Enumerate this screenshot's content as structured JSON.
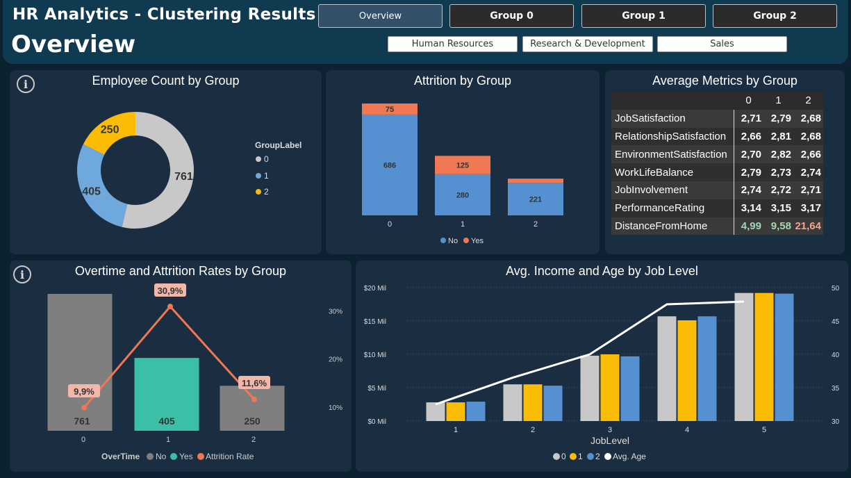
{
  "header": {
    "app_title": "HR Analytics - Clustering Results",
    "page_title": "Overview",
    "nav": [
      "Overview",
      "Group 0",
      "Group 1",
      "Group 2"
    ],
    "departments": [
      "Human Resources",
      "Research & Development",
      "Sales"
    ]
  },
  "colors": {
    "group0": "#c8c8c8",
    "group1": "#6fa8dc",
    "group2": "#fbbc05",
    "no": "#5591d1",
    "yes": "#f07853"
  },
  "donut": {
    "title": "Employee Count by Group",
    "legend_title": "GroupLabel",
    "legend": [
      "0",
      "1",
      "2"
    ],
    "chart_data": {
      "type": "pie",
      "categories": [
        "0",
        "1",
        "2"
      ],
      "values": [
        761,
        405,
        250
      ],
      "labels": [
        "761",
        "405",
        "250"
      ]
    }
  },
  "attrition": {
    "title": "Attrition by Group",
    "legend": [
      "No",
      "Yes"
    ],
    "chart_data": {
      "type": "bar",
      "categories": [
        "0",
        "1",
        "2"
      ],
      "series": [
        {
          "name": "No",
          "values": [
            686,
            280,
            221
          ],
          "labels": [
            "686",
            "280",
            "221"
          ]
        },
        {
          "name": "Yes",
          "values": [
            75,
            125,
            29
          ],
          "labels": [
            "75",
            "125",
            ""
          ]
        }
      ]
    }
  },
  "metrics": {
    "title": "Average Metrics by Group",
    "columns": [
      "0",
      "1",
      "2"
    ],
    "rows": [
      {
        "label": "JobSatisfaction",
        "v": [
          "2,71",
          "2,79",
          "2,68"
        ]
      },
      {
        "label": "RelationshipSatisfaction",
        "v": [
          "2,66",
          "2,81",
          "2,68"
        ]
      },
      {
        "label": "EnvironmentSatisfaction",
        "v": [
          "2,70",
          "2,82",
          "2,66"
        ]
      },
      {
        "label": "WorkLifeBalance",
        "v": [
          "2,79",
          "2,73",
          "2,74"
        ]
      },
      {
        "label": "JobInvolvement",
        "v": [
          "2,74",
          "2,72",
          "2,71"
        ]
      },
      {
        "label": "PerformanceRating",
        "v": [
          "3,14",
          "3,15",
          "3,17"
        ]
      },
      {
        "label": "DistanceFromHome",
        "v": [
          "4,99",
          "9,58",
          "21,64"
        ]
      }
    ]
  },
  "overtime": {
    "title": "Overtime and Attrition Rates by Group",
    "legend_title": "OverTime",
    "legend": [
      "No",
      "Yes",
      "Attrition Rate"
    ],
    "chart_data": {
      "type": "bar",
      "categories": [
        "0",
        "1",
        "2"
      ],
      "bar_labels": [
        "761",
        "405",
        "250"
      ],
      "bar_overtime": [
        "No",
        "Yes",
        "No"
      ],
      "attrition_rate": [
        9.9,
        30.9,
        11.6
      ],
      "rate_labels": [
        "9,9%",
        "30,9%",
        "11,6%"
      ],
      "y2_ticks": [
        "30%",
        "20%",
        "10%"
      ]
    }
  },
  "income": {
    "title": "Avg. Income and Age by Job Level",
    "xlabel": "JobLevel",
    "legend": [
      "0",
      "1",
      "2",
      "Avg. Age"
    ],
    "chart_data": {
      "type": "bar",
      "categories": [
        "1",
        "2",
        "3",
        "4",
        "5"
      ],
      "series": [
        {
          "name": "0",
          "values": [
            2.8,
            5.5,
            9.8,
            15.7,
            19.2
          ]
        },
        {
          "name": "1",
          "values": [
            2.8,
            5.5,
            10.0,
            15.1,
            19.2
          ]
        },
        {
          "name": "2",
          "values": [
            2.9,
            5.3,
            9.7,
            15.7,
            19.1
          ]
        }
      ],
      "line": {
        "name": "Avg. Age",
        "values": [
          32.5,
          36.5,
          40.0,
          47.5,
          47.9
        ]
      },
      "y_ticks": [
        "$20 Mil",
        "$15 Mil",
        "$10 Mil",
        "$5 Mil",
        "$0 Mil"
      ],
      "y2_ticks": [
        "50",
        "45",
        "40",
        "35",
        "30"
      ]
    }
  }
}
